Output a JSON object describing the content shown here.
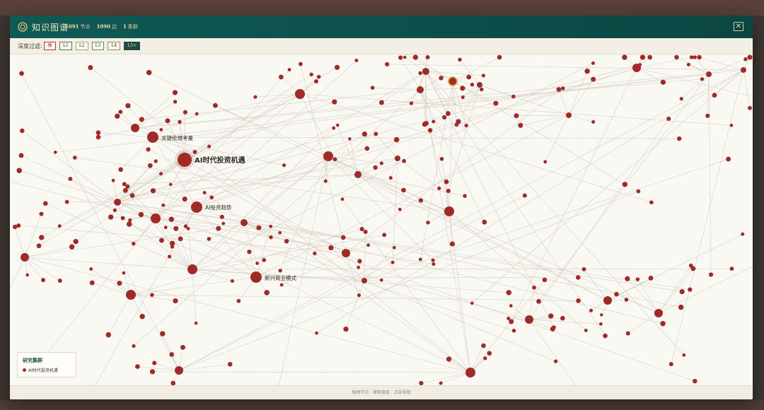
{
  "header": {
    "title": "知识图谱",
    "nodes_count": "1091",
    "nodes_unit": "节点",
    "edges_count": "1090",
    "edges_unit": "边",
    "clusters_count": "1",
    "clusters_unit": "集群",
    "close_glyph": "✕"
  },
  "filter": {
    "label": "深度过滤:",
    "buttons": [
      "根",
      "L1",
      "L2",
      "L3",
      "L4",
      "L5+"
    ],
    "active": "L5+"
  },
  "graph": {
    "labels": {
      "root": "AI时代投资机遇",
      "ethics": "关键伦理考量",
      "trends": "AI投资趋势",
      "models": "新兴商业模式"
    }
  },
  "legend": {
    "title": "研究集群",
    "item": "AI时代投资机遇"
  },
  "footer": {
    "hint": "拖拽节点 · 滚轮缩放 · 点击导航"
  },
  "colors": {
    "header_bg": "#0f5a55",
    "node": "#9f2a28",
    "highlight_ring": "#e0a63a",
    "active_filter": "#1f4a46"
  }
}
